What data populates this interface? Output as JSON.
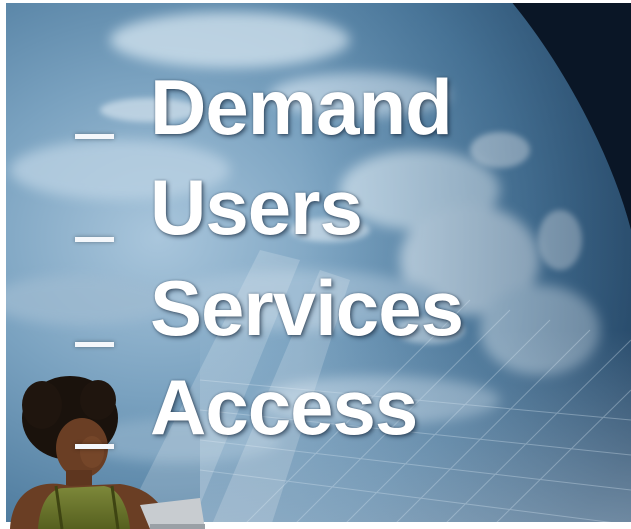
{
  "slide": {
    "items": [
      {
        "marker": "_",
        "text": "Demand"
      },
      {
        "marker": "_",
        "text": "Users"
      },
      {
        "marker": "_",
        "text": "Services"
      },
      {
        "marker": "_",
        "text": "Access"
      }
    ]
  },
  "colors": {
    "space": "#0b1a2c",
    "earth_ocean": "#4a7898",
    "earth_highlight": "#b8d2e2",
    "text": "#ffffff",
    "shirt": "#6f7a2e",
    "skin": "#6a3e24"
  },
  "photo_elements": [
    "earth-from-space",
    "grid-overlay",
    "person-at-computer"
  ]
}
